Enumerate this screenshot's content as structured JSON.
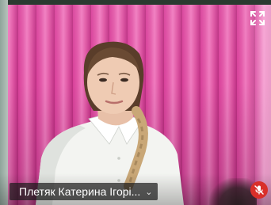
{
  "participant": {
    "name": "Плетяк Катерина Ігорі...",
    "menu_icon": "chevron-down-icon",
    "muted": true,
    "mic_icon": "mic-muted-icon"
  },
  "controls": {
    "expand_icon": "expand-icon"
  },
  "colors": {
    "blinds": "#e35aa9",
    "mic_badge": "#d92f2a",
    "name_bar": "#191919"
  }
}
